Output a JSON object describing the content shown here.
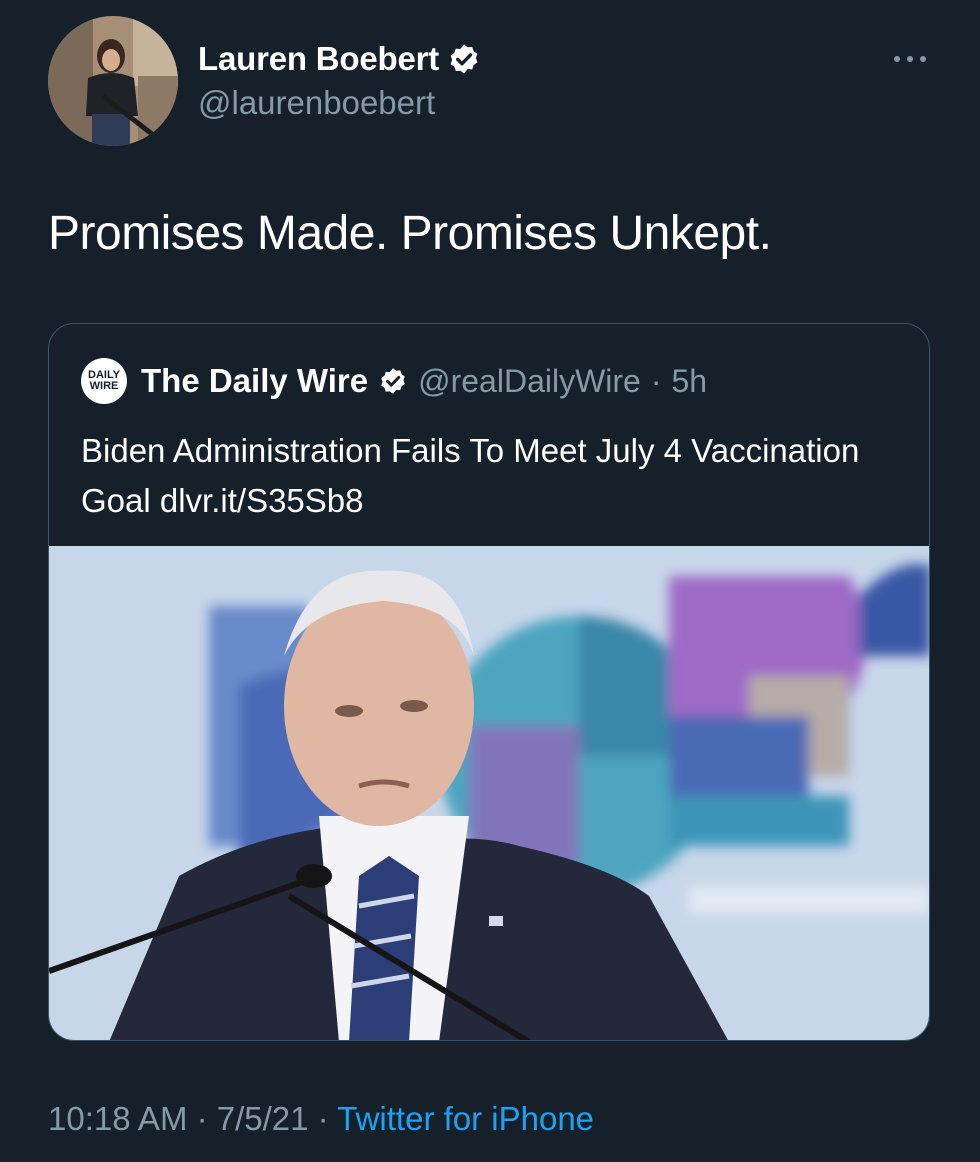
{
  "author": {
    "display_name": "Lauren Boebert",
    "handle": "@laurenboebert",
    "verified": true
  },
  "icons": {
    "verified": "verified-badge-icon",
    "more": "more-options-icon"
  },
  "tweet": {
    "text": "Promises Made. Promises Unkept."
  },
  "quoted_tweet": {
    "logo_line1": "DAILY",
    "logo_line2": "WIRE",
    "display_name": "The Daily Wire",
    "handle": "@realDailyWire",
    "separator": "·",
    "time_ago": "5h",
    "text": "Biden Administration Fails To Meet July 4 Vaccination Goal dlvr.it/S35Sb8"
  },
  "meta": {
    "time": "10:18 AM",
    "sep1": " · ",
    "date": "7/5/21",
    "sep2": " · ",
    "source": "Twitter for iPhone"
  },
  "colors": {
    "background": "#15202b",
    "secondary_text": "#8899a6",
    "link": "#1da1f2",
    "border": "#3d5466"
  }
}
